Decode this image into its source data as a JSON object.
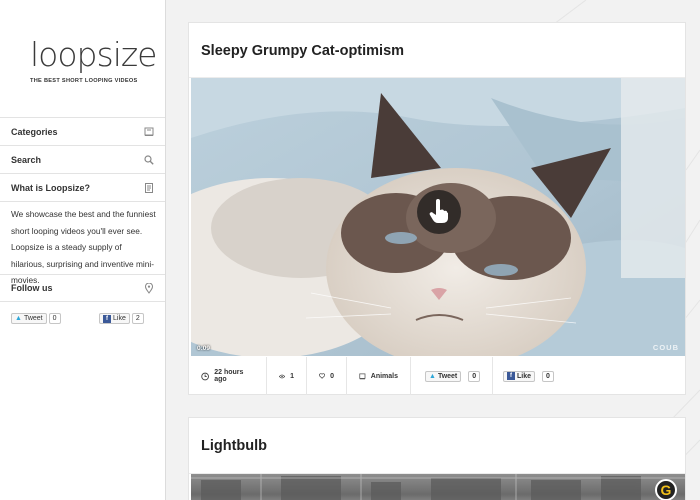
{
  "logo": {
    "wordmark": "loopsize",
    "tagline": "THE BEST SHORT LOOPING VIDEOS"
  },
  "sidebar": {
    "items": [
      {
        "label": "Categories",
        "icon": "book-icon"
      },
      {
        "label": "Search",
        "icon": "search-icon"
      },
      {
        "label": "What is Loopsize?",
        "icon": "document-icon"
      }
    ],
    "about_text": "We showcase the best and the funniest short looping videos you'll ever see. Loopsize is a steady supply of hilarious, surprising and inventive mini-movies.",
    "follow": {
      "label": "Follow us",
      "icon": "map-pin-icon"
    },
    "tweet_label": "Tweet",
    "tweet_count": "0",
    "like_label": "Like",
    "like_count": "2"
  },
  "posts": [
    {
      "title": "Sleepy Grumpy Cat-optimism",
      "video_time": "0:09",
      "video_brand": "COUB",
      "time_ago": "22 hours ago",
      "views": "1",
      "likes": "0",
      "category": "Animals",
      "tweet_label": "Tweet",
      "tweet_count": "0",
      "like_label": "Like",
      "like_count": "0"
    },
    {
      "title": "Lightbulb",
      "badge": "G"
    }
  ],
  "colors": {
    "accent": "#d9534f",
    "facebook": "#3b5998",
    "twitter": "#2fa7d8",
    "background": "#f2f2f2"
  }
}
